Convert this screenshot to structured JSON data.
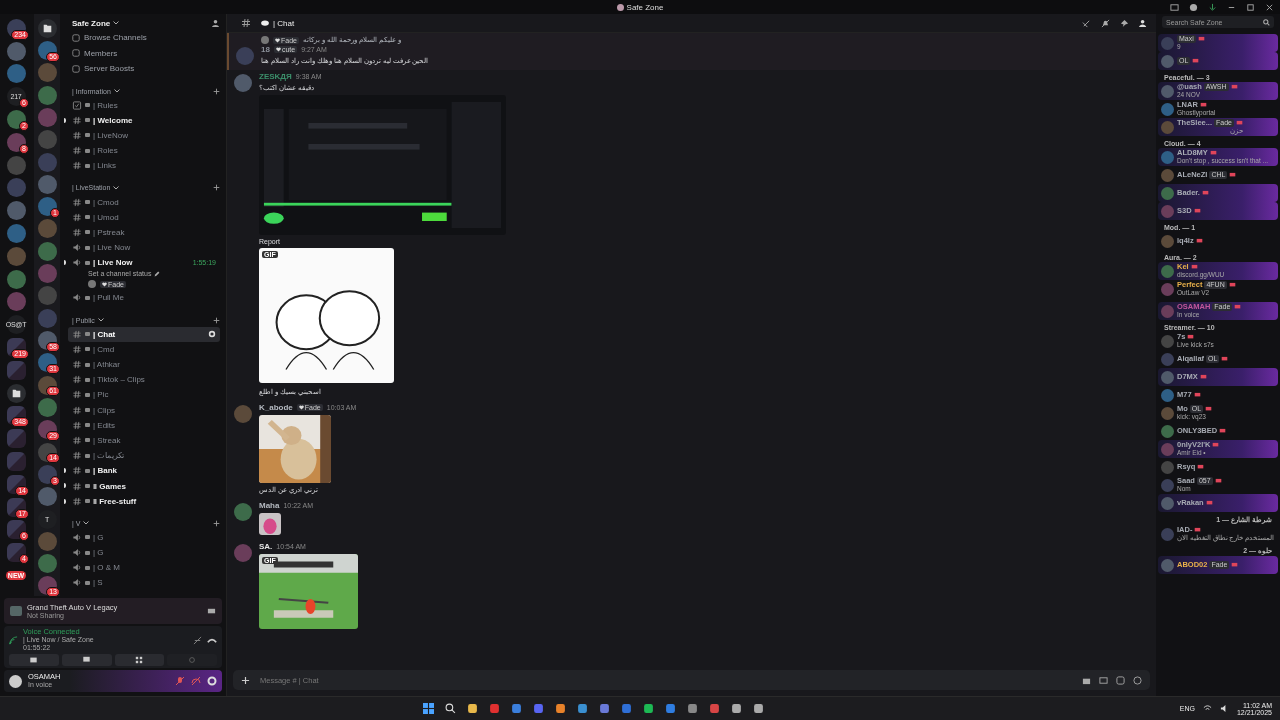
{
  "window": {
    "title": "Safe Zone"
  },
  "rail_a": [
    {
      "kind": "picture",
      "badge": "234"
    },
    {
      "kind": "picture"
    },
    {
      "kind": "picture"
    },
    {
      "kind": "text",
      "label": "217",
      "badge": "6"
    },
    {
      "kind": "picture",
      "badge": "2"
    },
    {
      "kind": "picture",
      "badge": "8"
    },
    {
      "kind": "picture"
    },
    {
      "kind": "picture"
    },
    {
      "kind": "picture"
    },
    {
      "kind": "picture"
    },
    {
      "kind": "picture"
    },
    {
      "kind": "picture"
    },
    {
      "kind": "picture"
    },
    {
      "kind": "text",
      "label": "OS@T"
    },
    {
      "kind": "folder",
      "badge": "219"
    },
    {
      "kind": "folder"
    },
    {
      "kind": "open-folder"
    },
    {
      "kind": "folder",
      "badge": "348"
    },
    {
      "kind": "folder"
    },
    {
      "kind": "folder"
    },
    {
      "kind": "folder",
      "badge": "14"
    },
    {
      "kind": "folder",
      "badge": "17"
    },
    {
      "kind": "folder",
      "badge": "6"
    },
    {
      "kind": "folder",
      "badge": "4"
    },
    {
      "kind": "new",
      "label": "NEW"
    }
  ],
  "rail_b": [
    {
      "kind": "open-folder"
    },
    {
      "kind": "picture",
      "badge": "56"
    },
    {
      "kind": "picture"
    },
    {
      "kind": "picture"
    },
    {
      "kind": "picture"
    },
    {
      "kind": "picture"
    },
    {
      "kind": "picture"
    },
    {
      "kind": "picture"
    },
    {
      "kind": "picture",
      "badge": "1"
    },
    {
      "kind": "picture"
    },
    {
      "kind": "picture"
    },
    {
      "kind": "picture"
    },
    {
      "kind": "picture"
    },
    {
      "kind": "picture"
    },
    {
      "kind": "picture",
      "badge": "58"
    },
    {
      "kind": "picture",
      "badge": "31"
    },
    {
      "kind": "picture",
      "badge": "61"
    },
    {
      "kind": "picture"
    },
    {
      "kind": "picture",
      "badge": "29"
    },
    {
      "kind": "picture",
      "badge": "14"
    },
    {
      "kind": "picture",
      "badge": "3"
    },
    {
      "kind": "picture"
    },
    {
      "kind": "text",
      "label": "T"
    },
    {
      "kind": "picture"
    },
    {
      "kind": "picture"
    },
    {
      "kind": "picture",
      "badge": "13"
    }
  ],
  "server": {
    "name": "Safe Zone",
    "links": [
      "Browse Channels",
      "Members",
      "Server Boosts"
    ]
  },
  "categories": [
    {
      "name": "| Information",
      "channels": [
        {
          "name": "| Rules",
          "kind": "rules",
          "unread": false,
          "selected": false
        },
        {
          "name": "| Welcome",
          "kind": "text",
          "unread": true,
          "selected": false
        },
        {
          "name": "| LiveNow",
          "kind": "text",
          "unread": false,
          "selected": false
        },
        {
          "name": "| Roles",
          "kind": "text",
          "unread": false,
          "selected": false
        },
        {
          "name": "| Links",
          "kind": "text",
          "unread": false,
          "selected": false
        }
      ]
    },
    {
      "name": "| LiveStation",
      "channels": [
        {
          "name": "| Cmod",
          "kind": "text",
          "unread": false,
          "selected": false
        },
        {
          "name": "| Umod",
          "kind": "text",
          "unread": false,
          "selected": false
        },
        {
          "name": "| Pstreak",
          "kind": "text",
          "unread": false,
          "selected": false
        },
        {
          "name": "| Live Now",
          "kind": "voice",
          "unread": false,
          "selected": false
        },
        {
          "name": "| Live Now",
          "kind": "voice",
          "unread": true,
          "selected": false,
          "timer": "1:55:19",
          "status": "Set a channel status",
          "users": [
            {
              "tag": "Fade"
            }
          ]
        },
        {
          "name": "| Pull Me",
          "kind": "voice",
          "unread": false,
          "selected": false
        }
      ]
    },
    {
      "name": "| Public",
      "channels": [
        {
          "name": "| Chat",
          "kind": "text",
          "unread": true,
          "selected": true
        },
        {
          "name": "| Cmd",
          "kind": "text",
          "unread": false,
          "selected": false
        },
        {
          "name": "| Athkar",
          "kind": "text",
          "unread": false,
          "selected": false
        },
        {
          "name": "| Tiktok – Clips",
          "kind": "text",
          "unread": false,
          "selected": false
        },
        {
          "name": "| Pic",
          "kind": "text",
          "unread": false,
          "selected": false
        },
        {
          "name": "| Clips",
          "kind": "text",
          "unread": false,
          "selected": false
        },
        {
          "name": "| Edits",
          "kind": "text",
          "unread": false,
          "selected": false
        },
        {
          "name": "| Streak",
          "kind": "text",
          "unread": false,
          "selected": false
        },
        {
          "name": "| تكريمات",
          "kind": "text",
          "unread": false,
          "selected": false
        },
        {
          "name": "| Bank",
          "kind": "text",
          "unread": true,
          "selected": false
        },
        {
          "name": "‖ Games",
          "kind": "text",
          "unread": true,
          "selected": false
        },
        {
          "name": "‖ Free-stuff",
          "kind": "text",
          "unread": true,
          "selected": false
        }
      ]
    },
    {
      "name": "| V",
      "channels": [
        {
          "name": "| G",
          "kind": "voice",
          "unread": false,
          "selected": false
        },
        {
          "name": "| G",
          "kind": "voice",
          "unread": false,
          "selected": false
        },
        {
          "name": "| O & M",
          "kind": "voice",
          "unread": false,
          "selected": false
        },
        {
          "name": "| S",
          "kind": "voice",
          "unread": false,
          "selected": false
        }
      ]
    }
  ],
  "activity": {
    "title": "Grand Theft Auto V Legacy",
    "subtitle": "Not Sharing"
  },
  "voice": {
    "status": "Voice Connected",
    "channel": "| Live Now / Safe Zone",
    "elapsed": "01:55:22"
  },
  "user": {
    "name": "OSAMAH",
    "status": "In voice"
  },
  "chat": {
    "channel": "| Chat",
    "search_placeholder": "Search Safe Zone",
    "input_placeholder": "Message # | Chat"
  },
  "messages": [
    {
      "reply": {
        "tag": "Fade",
        "text": "و عليكم السلام ورحمة الله و بركاته"
      },
      "author": "18",
      "tags": [
        "cute"
      ],
      "time": "9:27 AM",
      "lines": [
        "الحين عرفت ليه تردون السلام هنا وهلك وانت راد السلام هنا"
      ]
    },
    {
      "author": "ZESKДЯ",
      "color": "#3b8f6a",
      "time": "9:38 AM",
      "lines": [
        "دقيقه عشان اكتب؟"
      ],
      "attachments": [
        {
          "kind": "picture"
        },
        {
          "kind": "caption",
          "text": "Report"
        },
        {
          "kind": "picture",
          "badge": "GIF"
        }
      ]
    },
    {
      "lines": [
        "اسحبني بسيك و اطلع"
      ]
    },
    {
      "author": "K_abode",
      "color": "#b5bac1",
      "tags": [
        "Fade"
      ],
      "time": "10:03 AM",
      "attachments": [
        {
          "kind": "picture"
        },
        {
          "kind": "caption",
          "text": "ترني ادري عن الدس"
        }
      ]
    },
    {
      "author": "Maha",
      "color": "#b5bac1",
      "time": "10:22 AM",
      "attachments": [
        {
          "kind": "picture"
        }
      ]
    },
    {
      "author": "SA.",
      "color": "#e6e6e6",
      "time": "10:54 AM",
      "attachments": [
        {
          "kind": "picture",
          "badge": "GIF"
        }
      ]
    }
  ],
  "member_groups": [
    {
      "members": [
        {
          "tag": "Maxi",
          "status": "9",
          "banner": true
        },
        {
          "tag": "OL",
          "banner": true
        }
      ]
    },
    {
      "title": "Peaceful. — 3",
      "members": [
        {
          "name": "@uash",
          "tag": "AWSH",
          "status": "24 NOV",
          "banner": true
        },
        {
          "name": "LNAR",
          "status": "Ghostlyportal",
          "banner": false
        },
        {
          "name": "TheSlee...",
          "tag": "Fade",
          "status": "حزن",
          "banner": true
        }
      ]
    },
    {
      "title": "Cloud. — 4",
      "members": [
        {
          "name": "ALD8MY",
          "status": "Don't stop , success isn't that ...",
          "banner": true
        },
        {
          "name": "ALeNeZI",
          "tag": "CHL",
          "banner": false
        },
        {
          "name": "Bader.",
          "banner": true
        },
        {
          "name": "S3D",
          "banner": true
        }
      ]
    },
    {
      "title": "Mod. — 1",
      "members": [
        {
          "name": "lq4lz",
          "banner": false
        }
      ]
    },
    {
      "title": "Aura. — 2",
      "members": [
        {
          "name": "Kel",
          "color": "#e8b04a",
          "status": "discord.gg/WUU",
          "banner": true
        },
        {
          "name": "Perfect",
          "color": "#e8b04a",
          "tag": "4FUN",
          "status": "OutLaw V2",
          "banner": false
        }
      ]
    },
    {
      "members": [
        {
          "name": "OSAMAH",
          "color": "#c0569a",
          "tag": "Fade",
          "status": "In voice",
          "banner": true
        }
      ]
    },
    {
      "title": "Streamer. — 10",
      "members": [
        {
          "name": "7s",
          "status": "Live kick s7s",
          "banner": false
        },
        {
          "name": "Alqallaf",
          "tag": "OL",
          "banner": false
        },
        {
          "name": "D7MX",
          "banner": true
        },
        {
          "name": "M77",
          "banner": false
        },
        {
          "name": "Mo",
          "tag": "OL",
          "status": "kick: vq23",
          "banner": false
        },
        {
          "name": "ONLY3BED",
          "banner": false
        },
        {
          "name": "0nlyV2I'K",
          "status": "Amir Eid •",
          "banner": true
        },
        {
          "name": "Rsyq",
          "banner": false
        },
        {
          "name": "Saad",
          "tag": "057",
          "status": "Nom",
          "banner": false
        },
        {
          "name": "vRakan",
          "banner": true
        }
      ]
    },
    {
      "title": "شرطة الشارع — 1",
      "members": [
        {
          "name": "IAD-",
          "status": "المستخدم خارج نطاق التغطيه الان",
          "banner": false
        }
      ]
    },
    {
      "title": "حلوه — 2",
      "members": [
        {
          "name": "ABOD02",
          "color": "#e8b04a",
          "tag": "Fade",
          "banner": true
        }
      ]
    }
  ],
  "taskbar": {
    "language": "ENG",
    "time": "11:02 AM",
    "date": "12/21/2025"
  }
}
